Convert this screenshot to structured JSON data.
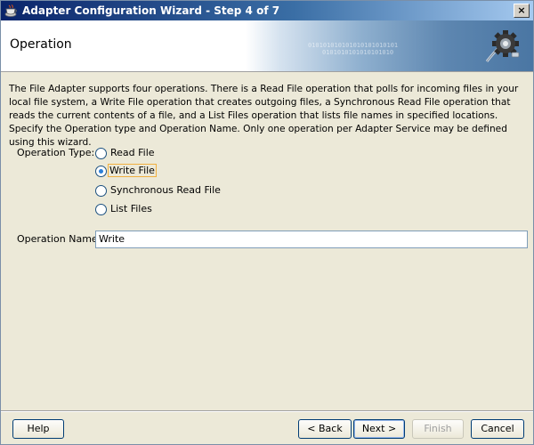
{
  "window": {
    "title": "Adapter Configuration Wizard - Step 4 of 7",
    "close_label": "×"
  },
  "header": {
    "page_title": "Operation",
    "banner_bits_1": "010101010101010101010101",
    "banner_bits_2": "0101010101010101010"
  },
  "description": "The File Adapter supports four operations.  There is a Read File operation that polls for incoming files in your local file system, a Write File operation that creates outgoing files, a Synchronous Read File operation that reads the current contents of a file, and a List Files operation that lists file names in specified locations.  Specify the Operation type and Operation Name.  Only one operation per Adapter Service may be defined using this wizard.",
  "operation_type": {
    "label": "Operation Type:",
    "options": [
      {
        "label": "Read File",
        "checked": false
      },
      {
        "label": "Write File",
        "checked": true
      },
      {
        "label": "Synchronous Read File",
        "checked": false
      },
      {
        "label": "List Files",
        "checked": false
      }
    ]
  },
  "operation_name": {
    "label": "Operation Name:",
    "value": "Write"
  },
  "buttons": {
    "help": "Help",
    "back": "< Back",
    "next": "Next >",
    "finish": "Finish",
    "cancel": "Cancel"
  }
}
